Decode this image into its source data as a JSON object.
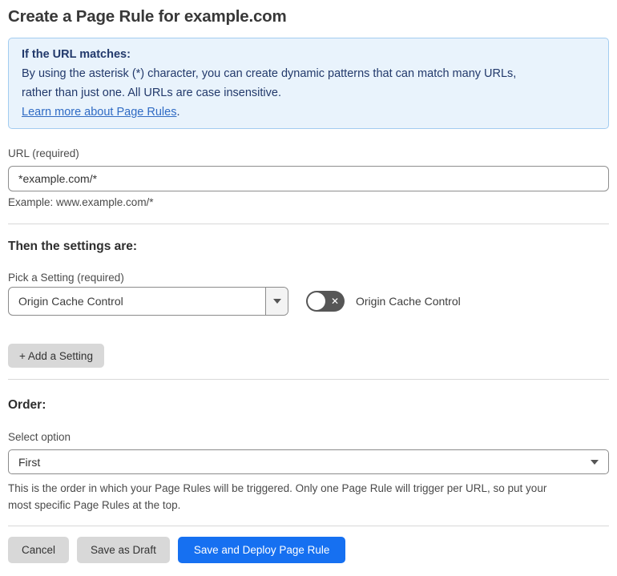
{
  "title": "Create a Page Rule for example.com",
  "info_box": {
    "heading": "If the URL matches:",
    "body_line1": "By using the asterisk (*) character, you can create dynamic patterns that can match many URLs,",
    "body_line2": "rather than just one. All URLs are case insensitive.",
    "link_label": "Learn more about Page Rules",
    "link_suffix": "."
  },
  "url_section": {
    "label": "URL (required)",
    "value": "*example.com/*",
    "helper": "Example: www.example.com/*"
  },
  "settings_section": {
    "heading": "Then the settings are:",
    "pick_label": "Pick a Setting (required)",
    "selected_setting": "Origin Cache Control",
    "toggle": {
      "label": "Origin Cache Control",
      "state": "off",
      "off_glyph": "✕"
    },
    "add_button": "+ Add a Setting"
  },
  "order_section": {
    "heading": "Order:",
    "label": "Select option",
    "selected_option": "First",
    "helper_line1": "This is the order in which your Page Rules will be triggered. Only one Page Rule will trigger per URL, so put your",
    "helper_line2": "most specific Page Rules at the top."
  },
  "footer": {
    "cancel": "Cancel",
    "save_draft": "Save as Draft",
    "save_deploy": "Save and Deploy Page Rule"
  },
  "colors": {
    "info_bg": "#e9f3fc",
    "info_border": "#a3ccf0",
    "info_text": "#22396b",
    "link": "#2f6bc4",
    "primary_button": "#1670f1",
    "toggle_off": "#565656",
    "gray_button": "#d8d8d8"
  }
}
